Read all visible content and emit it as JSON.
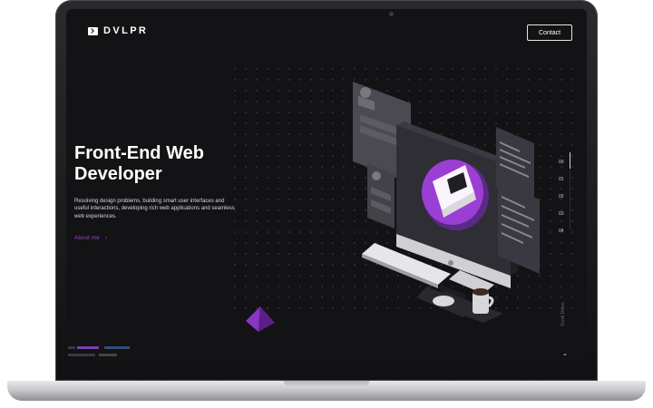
{
  "header": {
    "logo_text": "DVLPR",
    "contact_label": "Contact"
  },
  "hero": {
    "title_line1": "Front-End Web",
    "title_line2": "Developer",
    "description": "Resolving design problems, building smart user interfaces and useful interactions, developing rich web applications and seamless web experiences.",
    "about_link": "About me",
    "about_arrow": "›"
  },
  "pager": {
    "items": [
      "00",
      "01",
      "02",
      "03",
      "04"
    ]
  },
  "scroll": {
    "label": "Scroll Down",
    "chevron": "⌄"
  },
  "colors": {
    "accent": "#9b3fd4",
    "background": "#131214"
  }
}
